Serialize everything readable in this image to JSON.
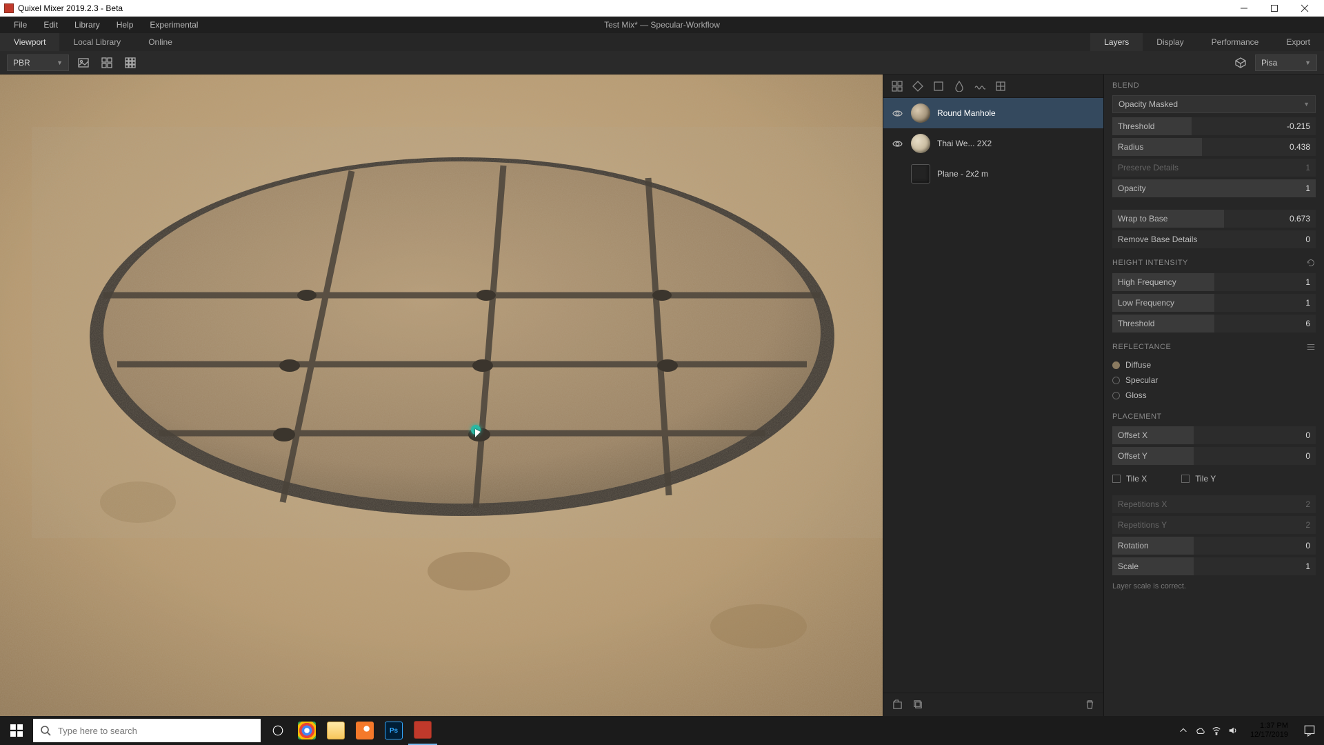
{
  "window": {
    "title": "Quixel Mixer 2019.2.3 - Beta"
  },
  "menubar": {
    "items": [
      "File",
      "Edit",
      "Library",
      "Help",
      "Experimental"
    ],
    "center": "Test Mix* — Specular-Workflow"
  },
  "tabs": {
    "left": [
      {
        "label": "Viewport",
        "active": true
      },
      {
        "label": "Local Library",
        "active": false
      },
      {
        "label": "Online",
        "active": false
      }
    ],
    "right": [
      {
        "label": "Layers",
        "active": true
      },
      {
        "label": "Display",
        "active": false
      },
      {
        "label": "Performance",
        "active": false
      },
      {
        "label": "Export",
        "active": false
      }
    ]
  },
  "toolbar": {
    "render_mode": "PBR",
    "environment": "Pisa"
  },
  "layers": {
    "items": [
      {
        "name": "Round Manhole",
        "visible": true,
        "selected": true,
        "thumb": "dark"
      },
      {
        "name": "Thai We... 2X2",
        "visible": true,
        "selected": false,
        "thumb": "light"
      },
      {
        "name": "Plane - 2x2 m",
        "visible": false,
        "selected": false,
        "thumb": "square"
      }
    ]
  },
  "props": {
    "blend": {
      "title": "BLEND",
      "mode": "Opacity Masked",
      "threshold": {
        "label": "Threshold",
        "value": "-0.215",
        "fill": 0.39
      },
      "radius": {
        "label": "Radius",
        "value": "0.438",
        "fill": 0.44
      },
      "preserve": {
        "label": "Preserve Details",
        "value": "1"
      },
      "opacity": {
        "label": "Opacity",
        "value": "1",
        "fill": 1
      },
      "wrap": {
        "label": "Wrap to Base",
        "value": "0.673",
        "fill": 0.55
      },
      "removebase": {
        "label": "Remove Base Details",
        "value": "0"
      }
    },
    "height": {
      "title": "HEIGHT INTENSITY",
      "high": {
        "label": "High Frequency",
        "value": "1",
        "fill": 0.5
      },
      "low": {
        "label": "Low Frequency",
        "value": "1",
        "fill": 0.5
      },
      "thresh": {
        "label": "Threshold",
        "value": "6",
        "fill": 0.5
      }
    },
    "reflect": {
      "title": "REFLECTANCE",
      "diffuse": "Diffuse",
      "specular": "Specular",
      "gloss": "Gloss"
    },
    "placement": {
      "title": "PLACEMENT",
      "offx": {
        "label": "Offset X",
        "value": "0",
        "fill": 0.4
      },
      "offy": {
        "label": "Offset Y",
        "value": "0",
        "fill": 0.4
      },
      "tilex": "Tile X",
      "tiley": "Tile Y",
      "repx": {
        "label": "Repetitions X",
        "value": "2"
      },
      "repy": {
        "label": "Repetitions Y",
        "value": "2"
      },
      "rot": {
        "label": "Rotation",
        "value": "0",
        "fill": 0.4
      },
      "scale": {
        "label": "Scale",
        "value": "1",
        "fill": 0.4
      }
    },
    "hint": "Layer scale is correct."
  },
  "taskbar": {
    "search_placeholder": "Type here to search",
    "time": "1:37 PM",
    "date": "12/17/2019"
  }
}
